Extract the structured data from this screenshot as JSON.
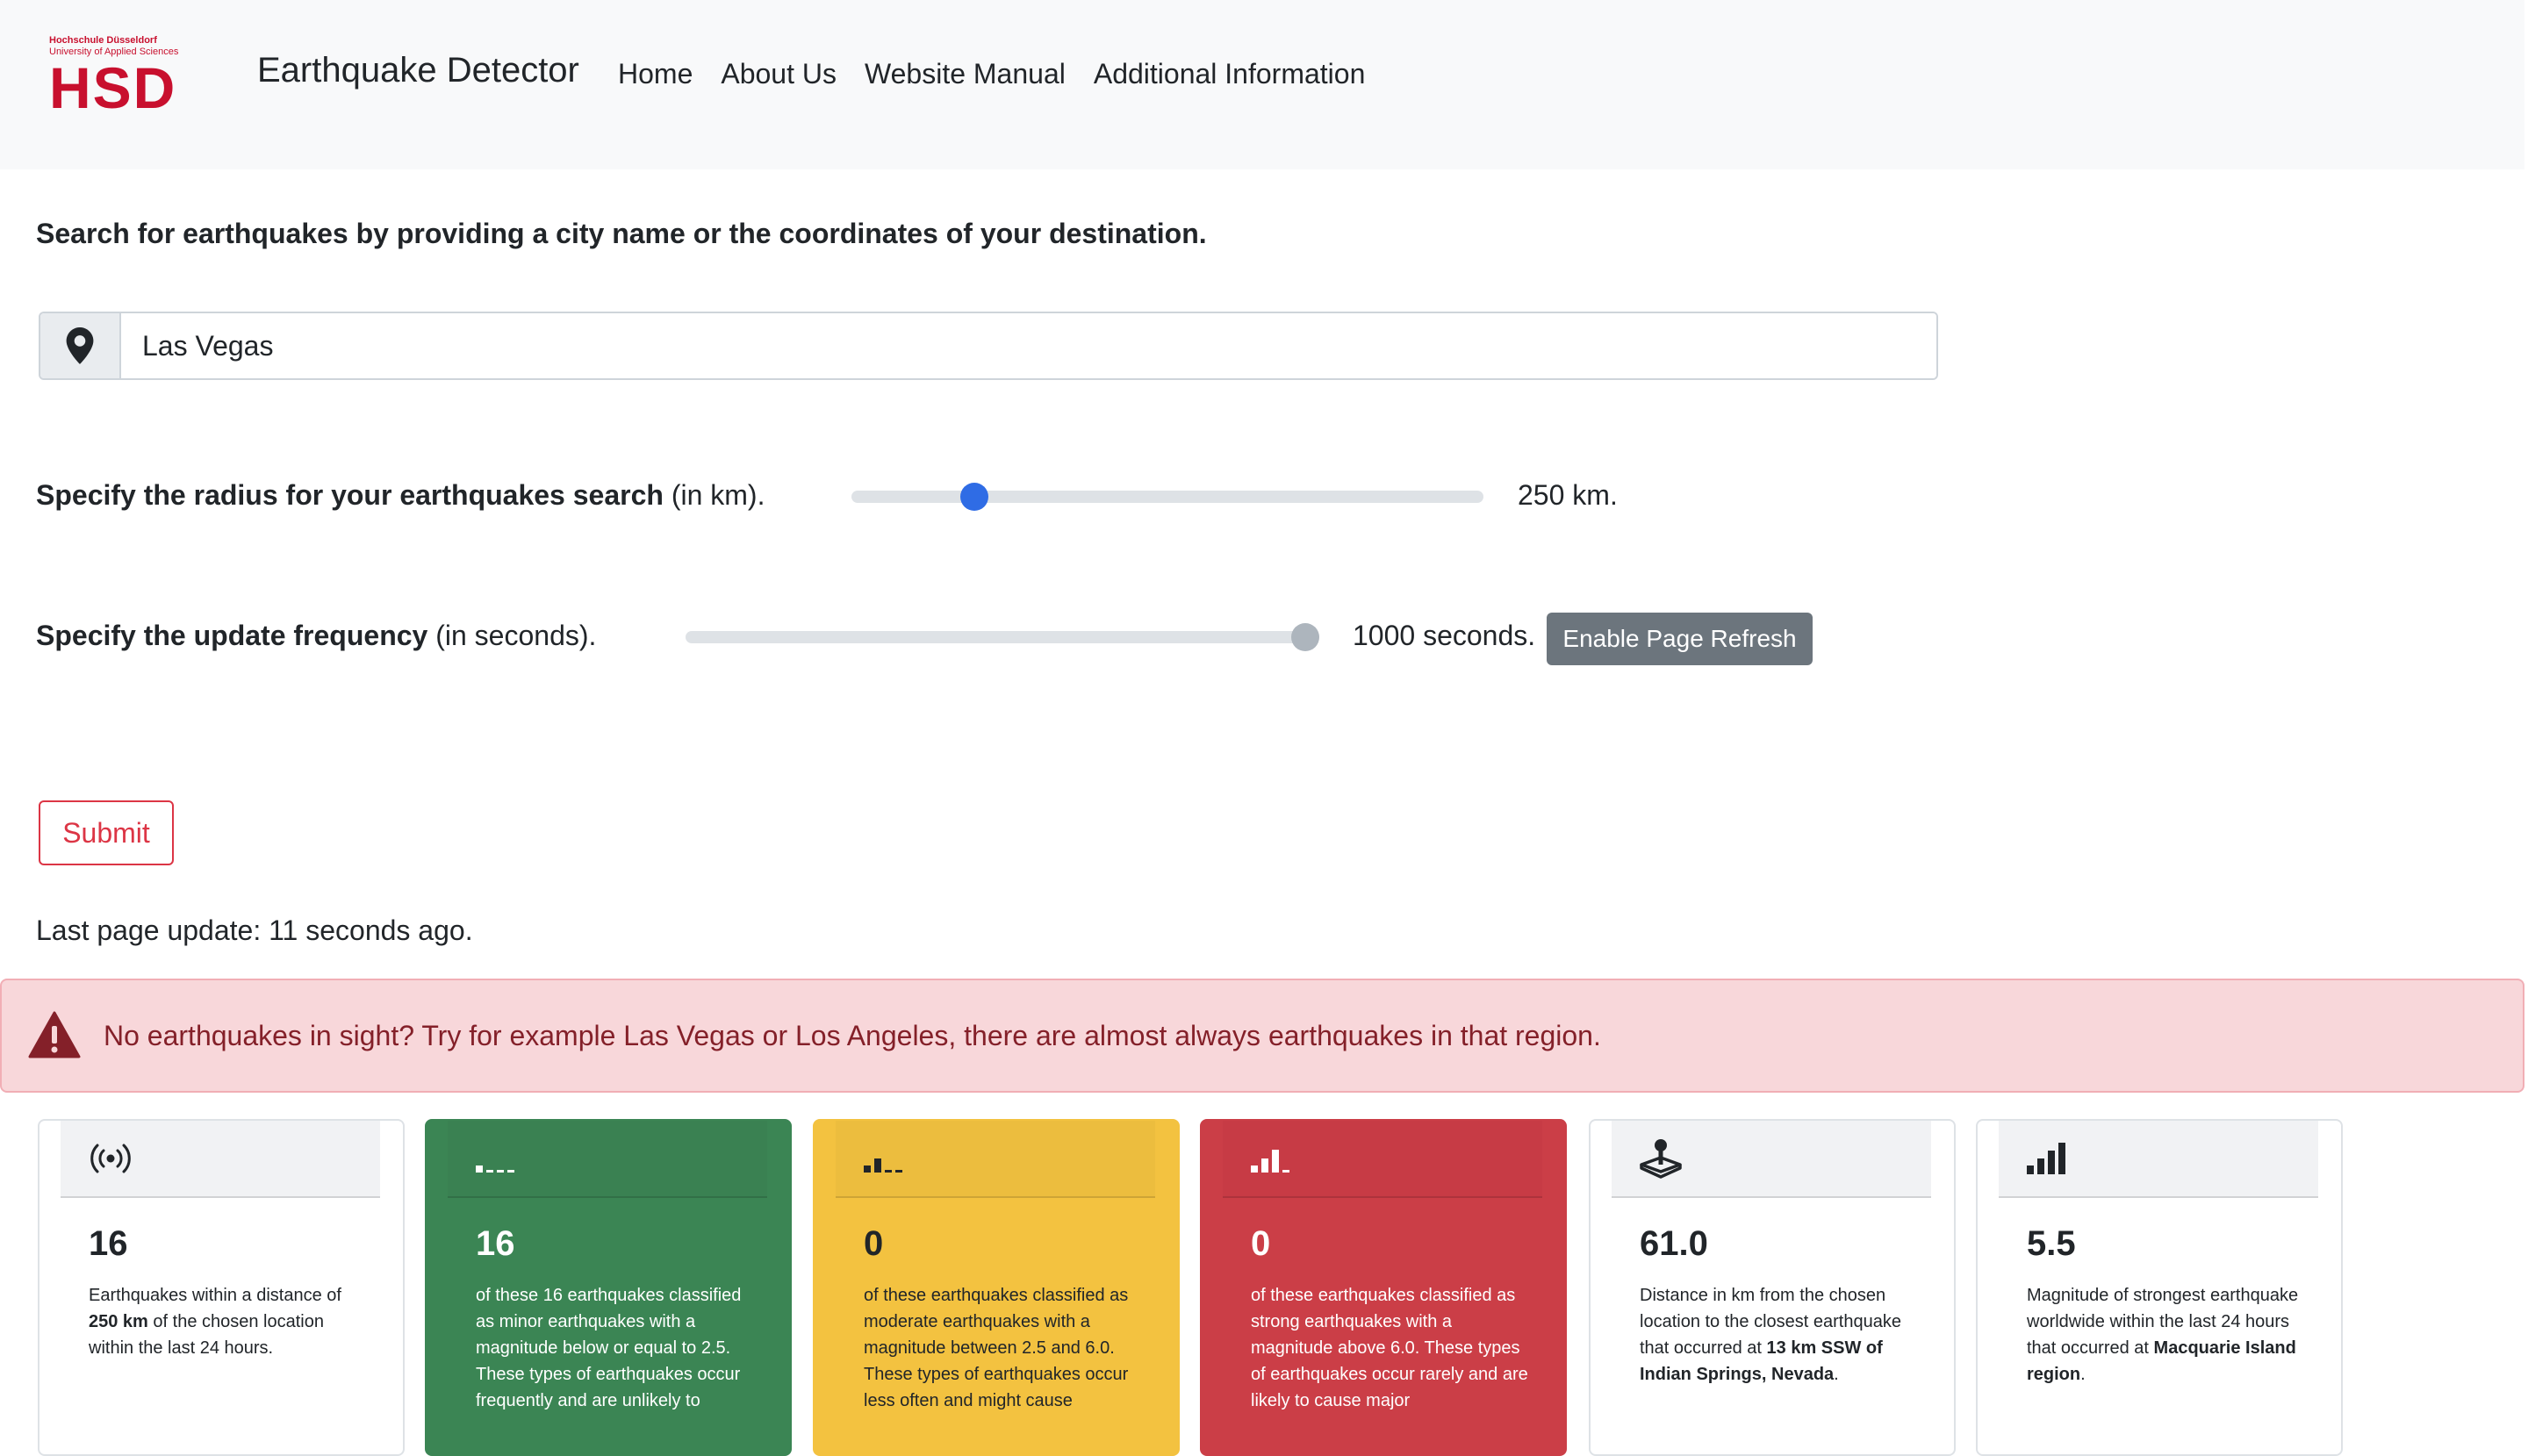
{
  "navbar": {
    "logo": {
      "line1": "Hochschule Düsseldorf",
      "line2": "University of Applied Sciences",
      "mark": "HSD"
    },
    "brand": "Earthquake Detector",
    "links": [
      "Home",
      "About Us",
      "Website Manual",
      "Additional Information"
    ]
  },
  "search": {
    "instruction": "Search for earthquakes by providing a city name or the coordinates of your destination.",
    "icon": "map-pin-icon",
    "value": "Las Vegas"
  },
  "radius": {
    "label_bold": "Specify the radius for your earthquakes search",
    "label_rest": " (in km).",
    "level_fraction": 0.18,
    "value_text": "250 km."
  },
  "frequency": {
    "label_bold": "Specify the update frequency",
    "label_rest": " (in seconds).",
    "level_fraction": 1.0,
    "value_text": "1000 seconds.",
    "refresh_button": "Enable Page Refresh"
  },
  "submit_label": "Submit",
  "last_update": "Last page update: 11 seconds ago.",
  "alert": {
    "icon": "warning-triangle-icon",
    "text": "No earthquakes in sight? Try for example Las Vegas or Los Angeles, there are almost always earthquakes in that region."
  },
  "cards": [
    {
      "style": "plain",
      "icon": "broadcast-icon",
      "value": "16",
      "text_before": "Earthquakes within a distance of ",
      "text_bold": "250 km",
      "text_after": " of the chosen location within the last 24 hours."
    },
    {
      "style": "green",
      "icon": "signal-1-bar-icon",
      "value": "16",
      "text": "of these 16 earthquakes classified as minor earthquakes with a magnitude below or equal to 2.5. These types of earthquakes occur frequently and are unlikely to"
    },
    {
      "style": "yellow",
      "icon": "signal-2-bars-icon",
      "value": "0",
      "text": "of these earthquakes classified as moderate earthquakes with a magnitude between 2.5 and 6.0. These types of earthquakes occur less often and might cause"
    },
    {
      "style": "red",
      "icon": "signal-3-bars-icon",
      "value": "0",
      "text": "of these earthquakes classified as strong earthquakes with a magnitude above 6.0. These types of earthquakes occur rarely and are likely to cause major"
    },
    {
      "style": "plain",
      "icon": "joystick-icon",
      "value": "61.0",
      "text_before": "Distance in km from the chosen location to the closest earthquake that occurred at ",
      "text_bold": "13 km SSW of Indian Springs, Nevada",
      "text_after": "."
    },
    {
      "style": "plain",
      "icon": "signal-full-icon",
      "value": "5.5",
      "text_before": "Magnitude of strongest earthquake worldwide within the last 24 hours that occurred at ",
      "text_bold": "Macquarie Island region",
      "text_after": "."
    }
  ],
  "colors": {
    "brand_red": "#c8102e",
    "slider_active": "#2f6ce5",
    "minor_green": "#3b8554",
    "moderate_yellow": "#f3c240",
    "strong_red": "#cb3e47",
    "alert_bg": "#f8d7da",
    "alert_text": "#842029"
  }
}
